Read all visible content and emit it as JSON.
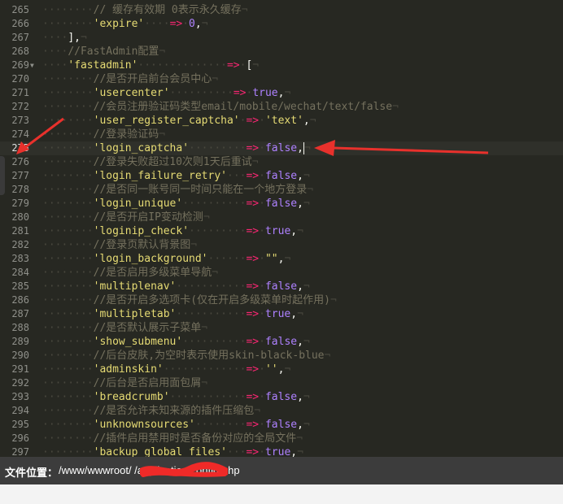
{
  "editor": {
    "lines": [
      {
        "num": "265",
        "indent": 2,
        "tokens": [
          {
            "t": "cm",
            "v": "// 缓存有效期 0表示永久缓存"
          }
        ]
      },
      {
        "num": "266",
        "indent": 2,
        "tokens": [
          {
            "t": "st",
            "v": "'expire'"
          },
          {
            "t": "ws",
            "v": "····"
          },
          {
            "t": "op",
            "v": "=>"
          },
          {
            "t": "ws",
            "v": "·"
          },
          {
            "t": "nu",
            "v": "0"
          },
          {
            "t": "pu",
            "v": ","
          }
        ]
      },
      {
        "num": "267",
        "indent": 1,
        "tokens": [
          {
            "t": "pu",
            "v": "],"
          }
        ]
      },
      {
        "num": "268",
        "indent": 1,
        "tokens": [
          {
            "t": "cm",
            "v": "//FastAdmin配置"
          }
        ]
      },
      {
        "num": "269",
        "indent": 1,
        "fold": true,
        "tokens": [
          {
            "t": "st",
            "v": "'fastadmin'"
          },
          {
            "t": "ws",
            "v": "··············"
          },
          {
            "t": "op",
            "v": "=>"
          },
          {
            "t": "ws",
            "v": "·"
          },
          {
            "t": "pu",
            "v": "["
          }
        ]
      },
      {
        "num": "270",
        "indent": 2,
        "tokens": [
          {
            "t": "cm",
            "v": "//是否开启前台会员中心"
          }
        ]
      },
      {
        "num": "271",
        "indent": 2,
        "tokens": [
          {
            "t": "st",
            "v": "'usercenter'"
          },
          {
            "t": "ws",
            "v": "··········"
          },
          {
            "t": "op",
            "v": "=>"
          },
          {
            "t": "ws",
            "v": "·"
          },
          {
            "t": "nu",
            "v": "true"
          },
          {
            "t": "pu",
            "v": ","
          }
        ]
      },
      {
        "num": "272",
        "indent": 2,
        "tokens": [
          {
            "t": "cm",
            "v": "//会员注册验证码类型email/mobile/wechat/text/false"
          }
        ]
      },
      {
        "num": "273",
        "indent": 2,
        "tokens": [
          {
            "t": "st",
            "v": "'user_register_captcha'"
          },
          {
            "t": "ws",
            "v": "·"
          },
          {
            "t": "op",
            "v": "=>"
          },
          {
            "t": "ws",
            "v": "·"
          },
          {
            "t": "st",
            "v": "'text'"
          },
          {
            "t": "pu",
            "v": ","
          }
        ]
      },
      {
        "num": "274",
        "indent": 2,
        "tokens": [
          {
            "t": "cm",
            "v": "//登录验证码"
          }
        ]
      },
      {
        "num": "275",
        "indent": 2,
        "active": true,
        "cursor": true,
        "tokens": [
          {
            "t": "st",
            "v": "'login_captcha'"
          },
          {
            "t": "ws",
            "v": "·········"
          },
          {
            "t": "op",
            "v": "=>"
          },
          {
            "t": "ws",
            "v": "·"
          },
          {
            "t": "nu",
            "v": "false"
          },
          {
            "t": "pu",
            "v": ","
          }
        ]
      },
      {
        "num": "276",
        "indent": 2,
        "tokens": [
          {
            "t": "cm",
            "v": "//登录失败超过10次则1天后重试"
          }
        ]
      },
      {
        "num": "277",
        "indent": 2,
        "tokens": [
          {
            "t": "st",
            "v": "'login_failure_retry'"
          },
          {
            "t": "ws",
            "v": "···"
          },
          {
            "t": "op",
            "v": "=>"
          },
          {
            "t": "ws",
            "v": "·"
          },
          {
            "t": "nu",
            "v": "false"
          },
          {
            "t": "pu",
            "v": ","
          }
        ]
      },
      {
        "num": "278",
        "indent": 2,
        "tokens": [
          {
            "t": "cm",
            "v": "//是否同一账号同一时间只能在一个地方登录"
          }
        ]
      },
      {
        "num": "279",
        "indent": 2,
        "tokens": [
          {
            "t": "st",
            "v": "'login_unique'"
          },
          {
            "t": "ws",
            "v": "··········"
          },
          {
            "t": "op",
            "v": "=>"
          },
          {
            "t": "ws",
            "v": "·"
          },
          {
            "t": "nu",
            "v": "false"
          },
          {
            "t": "pu",
            "v": ","
          }
        ]
      },
      {
        "num": "280",
        "indent": 2,
        "tokens": [
          {
            "t": "cm",
            "v": "//是否开启IP变动检测"
          }
        ]
      },
      {
        "num": "281",
        "indent": 2,
        "tokens": [
          {
            "t": "st",
            "v": "'loginip_check'"
          },
          {
            "t": "ws",
            "v": "·········"
          },
          {
            "t": "op",
            "v": "=>"
          },
          {
            "t": "ws",
            "v": "·"
          },
          {
            "t": "nu",
            "v": "true"
          },
          {
            "t": "pu",
            "v": ","
          }
        ]
      },
      {
        "num": "282",
        "indent": 2,
        "tokens": [
          {
            "t": "cm",
            "v": "//登录页默认背景图"
          }
        ]
      },
      {
        "num": "283",
        "indent": 2,
        "tokens": [
          {
            "t": "st",
            "v": "'login_background'"
          },
          {
            "t": "ws",
            "v": "······"
          },
          {
            "t": "op",
            "v": "=>"
          },
          {
            "t": "ws",
            "v": "·"
          },
          {
            "t": "st",
            "v": "\"\""
          },
          {
            "t": "pu",
            "v": ","
          }
        ]
      },
      {
        "num": "284",
        "indent": 2,
        "tokens": [
          {
            "t": "cm",
            "v": "//是否启用多级菜单导航"
          }
        ]
      },
      {
        "num": "285",
        "indent": 2,
        "tokens": [
          {
            "t": "st",
            "v": "'multiplenav'"
          },
          {
            "t": "ws",
            "v": "···········"
          },
          {
            "t": "op",
            "v": "=>"
          },
          {
            "t": "ws",
            "v": "·"
          },
          {
            "t": "nu",
            "v": "false"
          },
          {
            "t": "pu",
            "v": ","
          }
        ]
      },
      {
        "num": "286",
        "indent": 2,
        "tokens": [
          {
            "t": "cm",
            "v": "//是否开启多选项卡(仅在开启多级菜单时起作用)"
          }
        ]
      },
      {
        "num": "287",
        "indent": 2,
        "tokens": [
          {
            "t": "st",
            "v": "'multipletab'"
          },
          {
            "t": "ws",
            "v": "···········"
          },
          {
            "t": "op",
            "v": "=>"
          },
          {
            "t": "ws",
            "v": "·"
          },
          {
            "t": "nu",
            "v": "true"
          },
          {
            "t": "pu",
            "v": ","
          }
        ]
      },
      {
        "num": "288",
        "indent": 2,
        "tokens": [
          {
            "t": "cm",
            "v": "//是否默认展示子菜单"
          }
        ]
      },
      {
        "num": "289",
        "indent": 2,
        "tokens": [
          {
            "t": "st",
            "v": "'show_submenu'"
          },
          {
            "t": "ws",
            "v": "··········"
          },
          {
            "t": "op",
            "v": "=>"
          },
          {
            "t": "ws",
            "v": "·"
          },
          {
            "t": "nu",
            "v": "false"
          },
          {
            "t": "pu",
            "v": ","
          }
        ]
      },
      {
        "num": "290",
        "indent": 2,
        "tokens": [
          {
            "t": "cm",
            "v": "//后台皮肤,为空时表示使用skin-black-blue"
          }
        ]
      },
      {
        "num": "291",
        "indent": 2,
        "tokens": [
          {
            "t": "st",
            "v": "'adminskin'"
          },
          {
            "t": "ws",
            "v": "·············"
          },
          {
            "t": "op",
            "v": "=>"
          },
          {
            "t": "ws",
            "v": "·"
          },
          {
            "t": "st",
            "v": "''"
          },
          {
            "t": "pu",
            "v": ","
          }
        ]
      },
      {
        "num": "292",
        "indent": 2,
        "tokens": [
          {
            "t": "cm",
            "v": "//后台是否启用面包屑"
          }
        ]
      },
      {
        "num": "293",
        "indent": 2,
        "tokens": [
          {
            "t": "st",
            "v": "'breadcrumb'"
          },
          {
            "t": "ws",
            "v": "············"
          },
          {
            "t": "op",
            "v": "=>"
          },
          {
            "t": "ws",
            "v": "·"
          },
          {
            "t": "nu",
            "v": "false"
          },
          {
            "t": "pu",
            "v": ","
          }
        ]
      },
      {
        "num": "294",
        "indent": 2,
        "tokens": [
          {
            "t": "cm",
            "v": "//是否允许未知来源的插件压缩包"
          }
        ]
      },
      {
        "num": "295",
        "indent": 2,
        "tokens": [
          {
            "t": "st",
            "v": "'unknownsources'"
          },
          {
            "t": "ws",
            "v": "········"
          },
          {
            "t": "op",
            "v": "=>"
          },
          {
            "t": "ws",
            "v": "·"
          },
          {
            "t": "nu",
            "v": "false"
          },
          {
            "t": "pu",
            "v": ","
          }
        ]
      },
      {
        "num": "296",
        "indent": 2,
        "tokens": [
          {
            "t": "cm",
            "v": "//插件启用禁用时是否备份对应的全局文件"
          }
        ]
      },
      {
        "num": "297",
        "indent": 2,
        "tokens": [
          {
            "t": "st",
            "v": "'backup_global_files'"
          },
          {
            "t": "ws",
            "v": "···"
          },
          {
            "t": "op",
            "v": "=>"
          },
          {
            "t": "ws",
            "v": "·"
          },
          {
            "t": "nu",
            "v": "true"
          },
          {
            "t": "pu",
            "v": ","
          }
        ]
      }
    ]
  },
  "status": {
    "label": "文件位置：",
    "path": "/www/wwwroot/                     /application/config.php"
  },
  "colors": {
    "annotation_arrow": "#e8312c",
    "redaction": "#ef2a28"
  }
}
